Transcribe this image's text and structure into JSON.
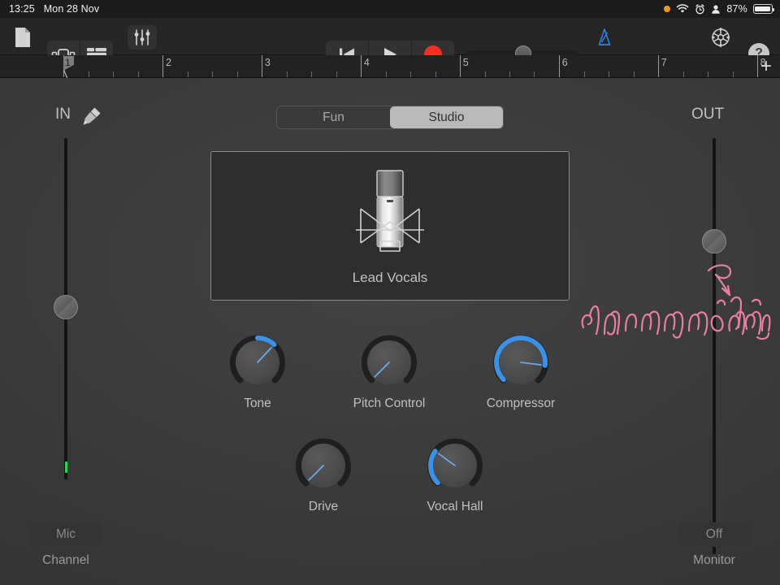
{
  "status_bar": {
    "time": "13:25",
    "date": "Mon 28 Nov",
    "battery_percent": "87%",
    "icons": [
      "recording-indicator-dot",
      "wifi-icon",
      "alarm-clock-icon",
      "person-icon",
      "battery-icon"
    ]
  },
  "toolbar": {
    "document_icon": "document-icon",
    "browser_view_icon": "instrument-browser-icon",
    "tracks_view_icon": "tracks-view-icon",
    "mixer_icon": "mixer-faders-icon",
    "rewind_icon": "rewind-to-start-icon",
    "play_icon": "play-icon",
    "record_icon": "record-icon",
    "master_volume_label": "master-volume-slider",
    "metronome_icon": "metronome-icon",
    "settings_icon": "gear-icon",
    "help_label": "?"
  },
  "ruler": {
    "bars": [
      "1",
      "2",
      "3",
      "4",
      "5",
      "6",
      "7",
      "8"
    ],
    "playhead_bar": "1",
    "add_track_label": "+"
  },
  "fx_tabs": {
    "options": [
      "Fun",
      "Studio"
    ],
    "selected": "Studio"
  },
  "instrument": {
    "name": "Lead Vocals",
    "icon": "condenser-microphone-icon"
  },
  "knobs": [
    {
      "label": "Tone",
      "value": 66,
      "angle": 43,
      "arc_from_min": false
    },
    {
      "label": "Pitch Control",
      "value": 0,
      "angle": -135,
      "arc_from_min": true
    },
    {
      "label": "Compressor",
      "value": 86,
      "angle": 97,
      "arc_from_min": true
    },
    {
      "label": "Drive",
      "value": 0,
      "angle": -135,
      "arc_from_min": true
    },
    {
      "label": "Vocal Hall",
      "value": 30,
      "angle": -54,
      "arc_from_min": true
    }
  ],
  "input_strip": {
    "title": "IN",
    "icon": "audio-jack-icon",
    "channel_button": "Mic",
    "channel_label": "Channel",
    "fader_value": 50
  },
  "output_strip": {
    "title": "OUT",
    "monitor_button": "Off",
    "monitor_label": "Monitor",
    "fader_value": 70
  },
  "annotation": {
    "text": "โปรแกรมอัดเสียง",
    "color": "#e87f9e",
    "shape": "handwritten-thai-text-with-arrow"
  },
  "colors": {
    "background": "#3a3a3a",
    "toolbar": "#262626",
    "accent_blue": "#3b90e8",
    "record_red": "#f52f22",
    "level_green": "#2ad74a",
    "annotation_pink": "#e87f9e"
  }
}
